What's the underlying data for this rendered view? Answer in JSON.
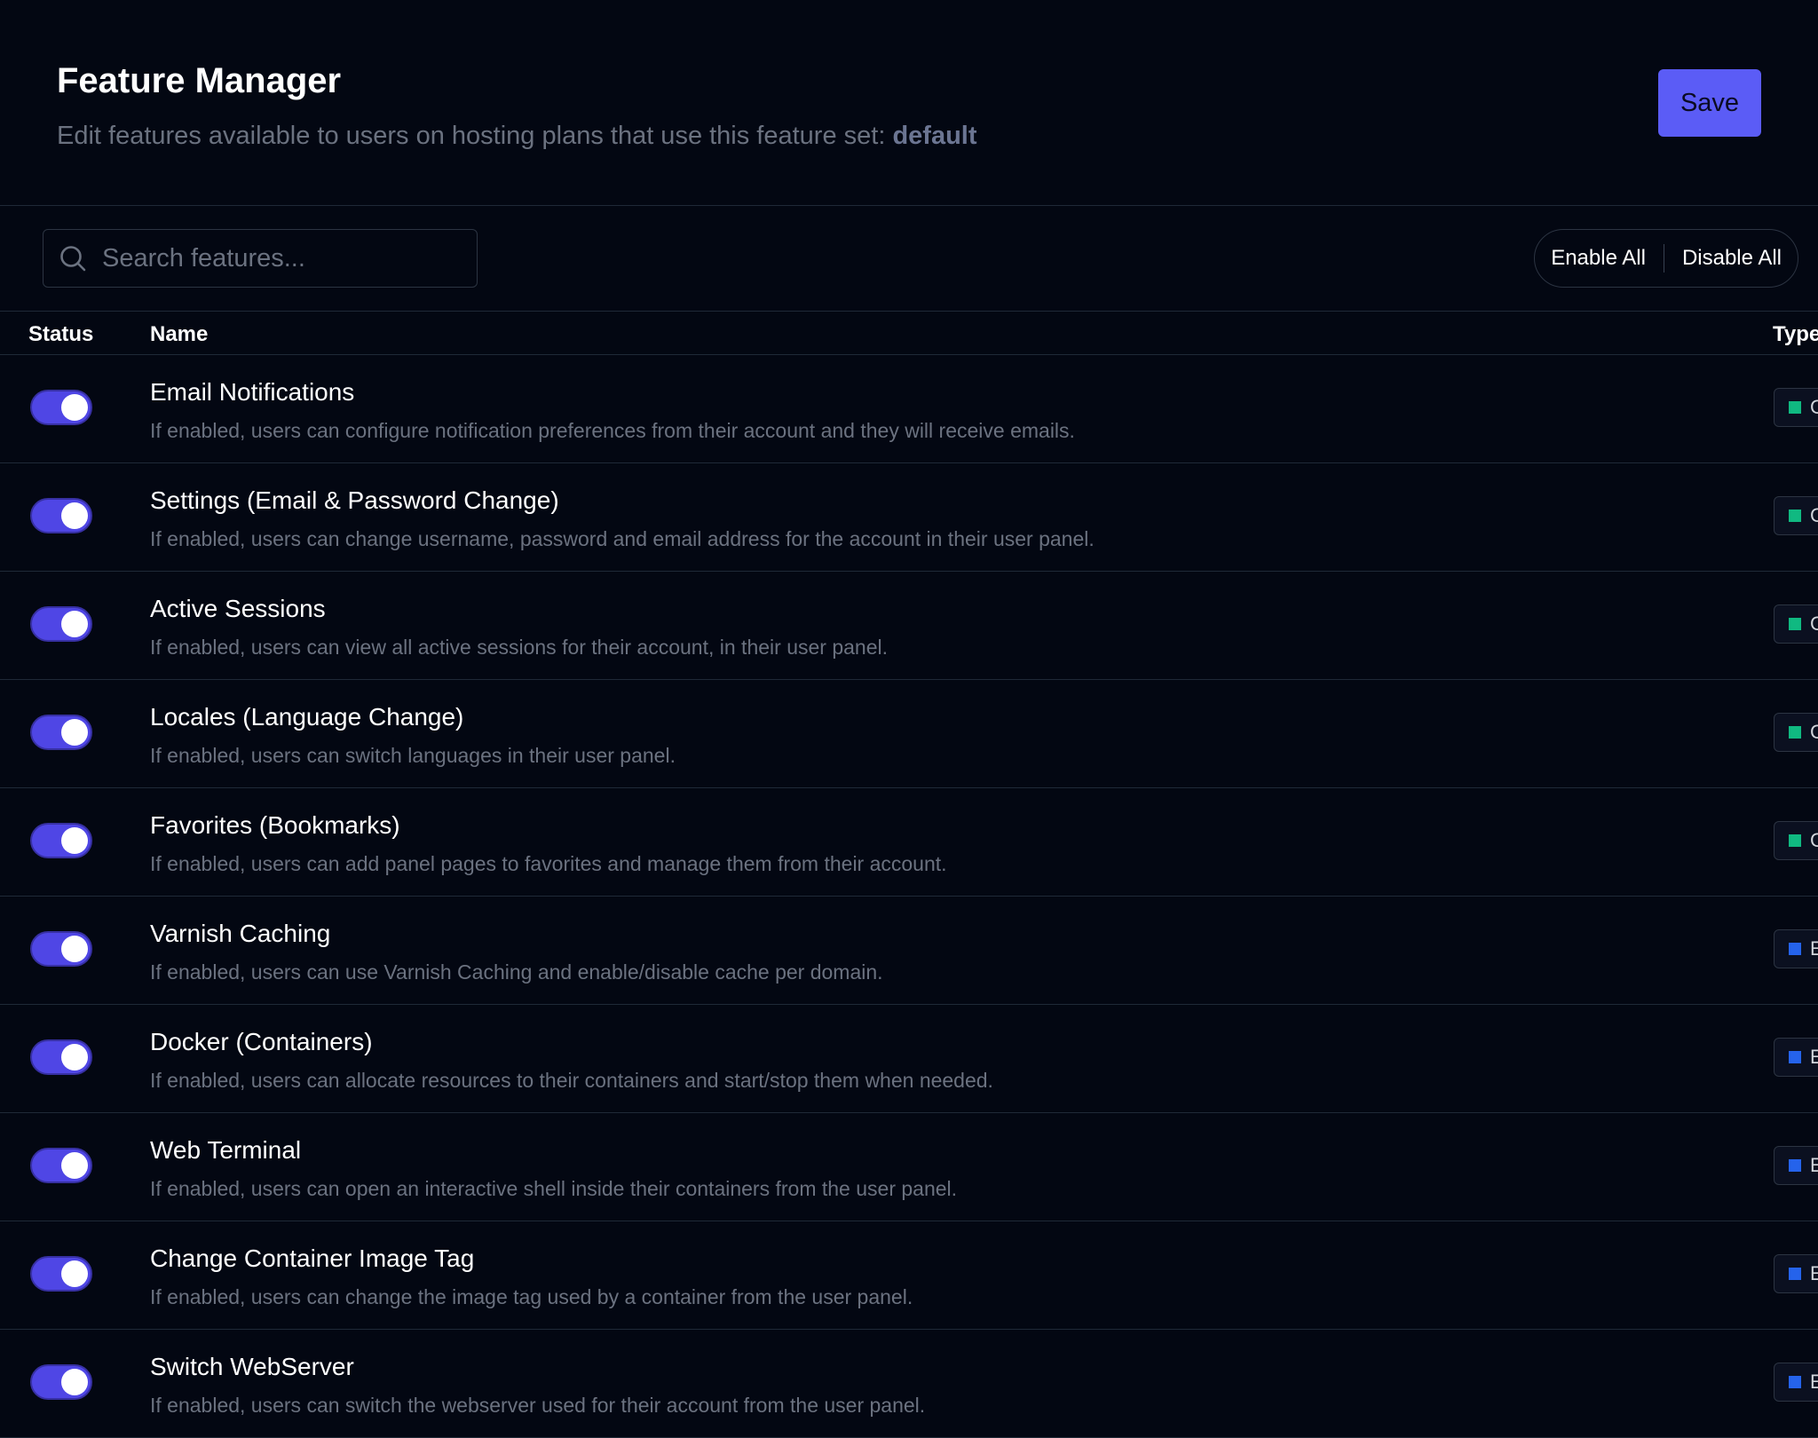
{
  "header": {
    "title": "Feature Manager",
    "subtitle_prefix": "Edit features available to users on hosting plans that use this feature set:",
    "feature_set": "default",
    "save_label": "Save"
  },
  "toolbar": {
    "search_placeholder": "Search features...",
    "enable_all_label": "Enable All",
    "disable_all_label": "Disable All"
  },
  "table": {
    "columns": {
      "status": "Status",
      "name": "Name",
      "type": "Type"
    },
    "rows": [
      {
        "name": "Email Notifications",
        "description": "If enabled, users can configure notification preferences from their account and they will receive emails.",
        "enabled": true,
        "type_label": "C",
        "type_color": "#10b981"
      },
      {
        "name": "Settings (Email & Password Change)",
        "description": "If enabled, users can change username, password and email address for the account in their user panel.",
        "enabled": true,
        "type_label": "C",
        "type_color": "#10b981"
      },
      {
        "name": "Active Sessions",
        "description": "If enabled, users can view all active sessions for their account, in their user panel.",
        "enabled": true,
        "type_label": "C",
        "type_color": "#10b981"
      },
      {
        "name": "Locales (Language Change)",
        "description": "If enabled, users can switch languages in their user panel.",
        "enabled": true,
        "type_label": "C",
        "type_color": "#10b981"
      },
      {
        "name": "Favorites (Bookmarks)",
        "description": "If enabled, users can add panel pages to favorites and manage them from their account.",
        "enabled": true,
        "type_label": "C",
        "type_color": "#10b981"
      },
      {
        "name": "Varnish Caching",
        "description": "If enabled, users can use Varnish Caching and enable/disable cache per domain.",
        "enabled": true,
        "type_label": "E",
        "type_color": "#2563eb"
      },
      {
        "name": "Docker (Containers)",
        "description": "If enabled, users can allocate resources to their containers and start/stop them when needed.",
        "enabled": true,
        "type_label": "E",
        "type_color": "#2563eb"
      },
      {
        "name": "Web Terminal",
        "description": "If enabled, users can open an interactive shell inside their containers from the user panel.",
        "enabled": true,
        "type_label": "E",
        "type_color": "#2563eb"
      },
      {
        "name": "Change Container Image Tag",
        "description": "If enabled, users can change the image tag used by a container from the user panel.",
        "enabled": true,
        "type_label": "E",
        "type_color": "#2563eb"
      },
      {
        "name": "Switch WebServer",
        "description": "If enabled, users can switch the webserver used for their account from the user panel.",
        "enabled": true,
        "type_label": "E",
        "type_color": "#2563eb"
      }
    ]
  },
  "colors": {
    "accent": "#5b5cf6",
    "toggle_on": "#4f46e5",
    "background": "#030712",
    "core_type": "#10b981",
    "extension_type": "#2563eb"
  }
}
